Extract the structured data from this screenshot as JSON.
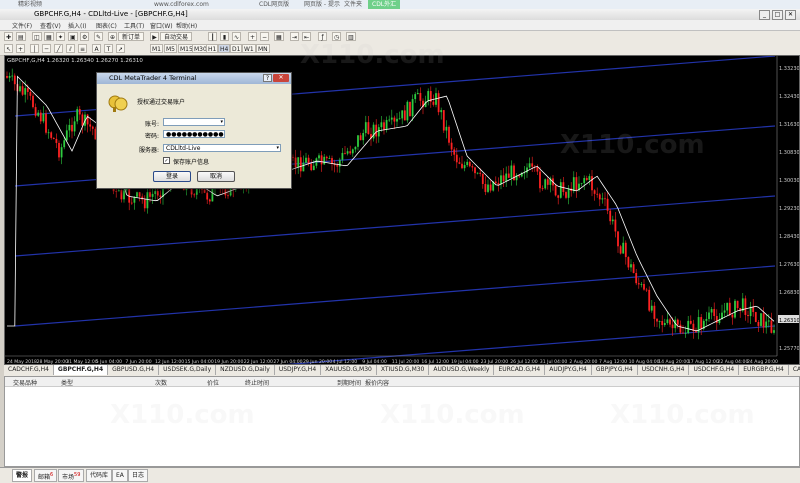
{
  "browser_tabs": [
    "精彩视频",
    "www.cdlforex.com",
    "CDL网页版",
    "网页版 - 提示",
    "文件夹",
    "CDL外汇"
  ],
  "window": {
    "title": "GBPCHF.G,H4 - CDLltd-Live - [GBPCHF.G,H4]"
  },
  "menu": [
    "文件(F)",
    "查看(V)",
    "插入(I)",
    "图表(C)",
    "工具(T)",
    "窗口(W)",
    "帮助(H)"
  ],
  "toolbar": {
    "new_order": "新订单",
    "auto_trade": "自动交易",
    "timeframes": [
      "M1",
      "M5",
      "M15",
      "M30",
      "H1",
      "H4",
      "D1",
      "W1",
      "MN"
    ]
  },
  "chart": {
    "symbol_label": "GBPCHF,G,H4  1.26320 1.26340 1.26270 1.26310",
    "price_axis": [
      "1.33230",
      "1.32430",
      "1.31630",
      "1.30830",
      "1.30030",
      "1.29230",
      "1.28430",
      "1.27630",
      "1.26830",
      "1.26310",
      "1.25770"
    ],
    "time_axis": [
      "24 May 2018",
      "28 May 20:00",
      "31 May 12:00",
      "5 Jun 04:00",
      "7 Jun 20:00",
      "12 Jun 12:00",
      "15 Jun 04:00",
      "19 Jun 20:00",
      "22 Jun 12:00",
      "27 Jun 04:00",
      "29 Jun 20:00",
      "4 Jul 12:00",
      "9 Jul 04:00",
      "11 Jul 20:00",
      "16 Jul 12:00",
      "19 Jul 04:00",
      "23 Jul 20:00",
      "26 Jul 12:00",
      "31 Jul 04:00",
      "2 Aug 20:00",
      "7 Aug 12:00",
      "10 Aug 04:00",
      "14 Aug 20:00",
      "17 Aug 12:00",
      "22 Aug 04:00",
      "24 Aug 20:00"
    ],
    "colors": {
      "up": "#2ecc40",
      "down": "#ff2222",
      "ma": "#ffffff",
      "channel": "#2233aa"
    }
  },
  "dialog": {
    "title": "CDL MetaTrader 4 Terminal",
    "heading": "授权通过交易账户",
    "account_label": "账号:",
    "password_label": "密码:",
    "password_value": "●●●●●●●●●●●",
    "server_label": "服务器:",
    "server_value": "CDLltd-Live",
    "save_label": "保存账户信息",
    "login_button": "登录",
    "cancel_button": "取消",
    "help": "?",
    "close": "✕"
  },
  "symbol_tabs": [
    "CADCHF.G,H4",
    "GBPCHF.G,H4",
    "GBPUSD.G,H4",
    "USDSEK.G,Daily",
    "NZDUSD.G,Daily",
    "USDJPY.G,H4",
    "XAUUSD.G,M30",
    "XTIUSD.G,M30",
    "AUDUSD.G,Weekly",
    "EURCAD.G,H4",
    "AUDJPY.G,H4",
    "GBPJPY.G,H4",
    "USDCNH.G,H4",
    "USDCHF.G,H4",
    "EURGBP.G,H4",
    "CADCH"
  ],
  "terminal_columns": [
    "交易品种",
    "类型",
    "次数",
    "价位",
    "终止时间",
    "到期时间",
    "报价内容"
  ],
  "bottom_tabs": [
    "警报",
    "邮箱",
    "市场",
    "代码库",
    "EA",
    "日志"
  ],
  "badges": {
    "mail": "6",
    "market": "59"
  },
  "watermark": "X110.com"
}
